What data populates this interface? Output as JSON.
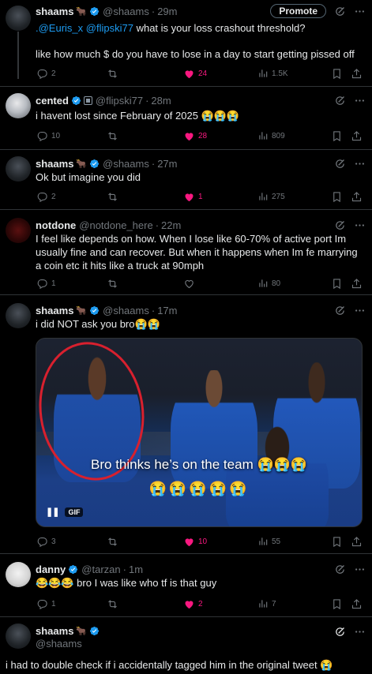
{
  "colors": {
    "accent": "#1d9bf0",
    "like": "#f91880",
    "muted": "#71767b",
    "bg": "#000000",
    "text": "#e7e9ea"
  },
  "tweets": [
    {
      "name": "shaams",
      "badge": "🐂",
      "handle": "@shaams",
      "time": "29m",
      "promote_label": "Promote",
      "mention1": ".@Euris_x",
      "mention2": "@flipski77",
      "text_rest": " what is your loss crashout threshold?",
      "text2": "like how much $ do you have to lose in a day to start getting pissed off",
      "replies": "2",
      "likes": "24",
      "views": "1.5K",
      "liked": true
    },
    {
      "name": "cented",
      "handle": "@flipski77",
      "time": "28m",
      "text": "i havent lost since February of 2025 😭😭😭",
      "replies": "10",
      "likes": "28",
      "views": "809",
      "liked": true
    },
    {
      "name": "shaams",
      "badge": "🐂",
      "handle": "@shaams",
      "time": "27m",
      "text": "Ok but imagine you did",
      "replies": "2",
      "likes": "1",
      "views": "275",
      "liked": true
    },
    {
      "name": "notdone",
      "handle": "@notdone_here",
      "time": "22m",
      "text": "I feel like depends on how. When I lose like 60-70% of active port Im usually fine and can recover. But when it happens when Im fe marrying a coin etc it hits like a truck at 90mph",
      "replies": "1",
      "likes": "",
      "views": "80",
      "liked": false
    },
    {
      "name": "shaams",
      "badge": "🐂",
      "handle": "@shaams",
      "time": "17m",
      "text": "i did NOT ask you bro😭😭",
      "media_caption": "Bro thinks he’s on the team 😭😭😭",
      "media_caption2": "😭😭😭😭😭",
      "gif_label": "GIF",
      "replies": "3",
      "likes": "10",
      "views": "55",
      "liked": true
    },
    {
      "name": "danny",
      "handle": "@tarzan",
      "time": "1m",
      "text": "😂😂😂 bro I was like who tf is that guy",
      "replies": "1",
      "likes": "2",
      "views": "7",
      "liked": true
    },
    {
      "name": "shaams",
      "badge": "🐂",
      "handle": "@shaams",
      "text": "i had to double check if i accidentally tagged him in the original tweet 😭"
    }
  ],
  "separator": "·"
}
